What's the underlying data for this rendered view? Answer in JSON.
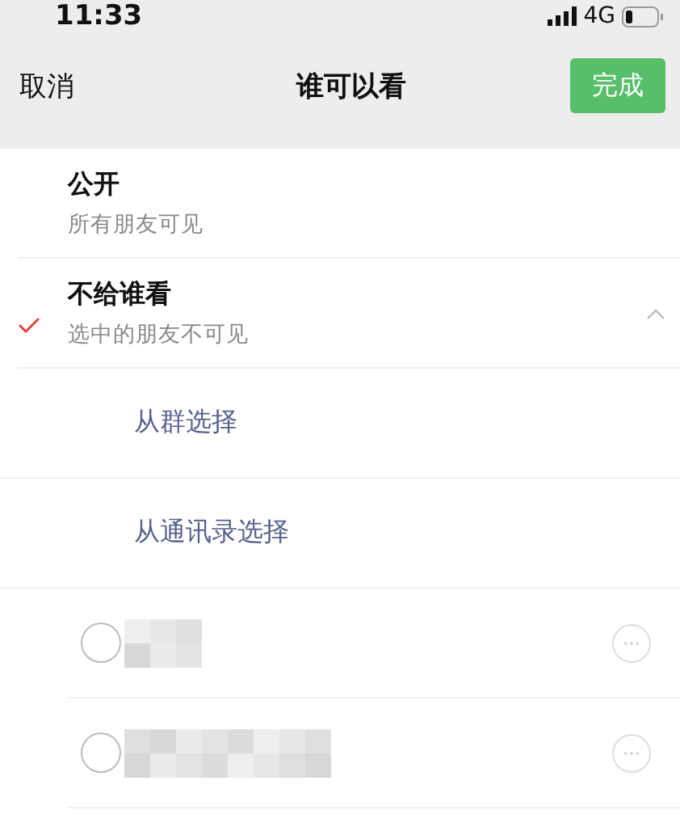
{
  "status_bar": {
    "time": "11:33",
    "network": "4G"
  },
  "nav": {
    "cancel": "取消",
    "title": "谁可以看",
    "done": "完成"
  },
  "options": [
    {
      "kind": "simple",
      "title": "公开",
      "subtitle": "所有朋友可见",
      "selected": false
    },
    {
      "kind": "group",
      "title": "不给谁看",
      "subtitle": "选中的朋友不可见",
      "selected": true,
      "expanded": true
    }
  ],
  "sources": [
    "从群选择",
    "从通讯录选择"
  ],
  "contacts": [
    {
      "selected": false
    },
    {
      "selected": false
    }
  ]
}
